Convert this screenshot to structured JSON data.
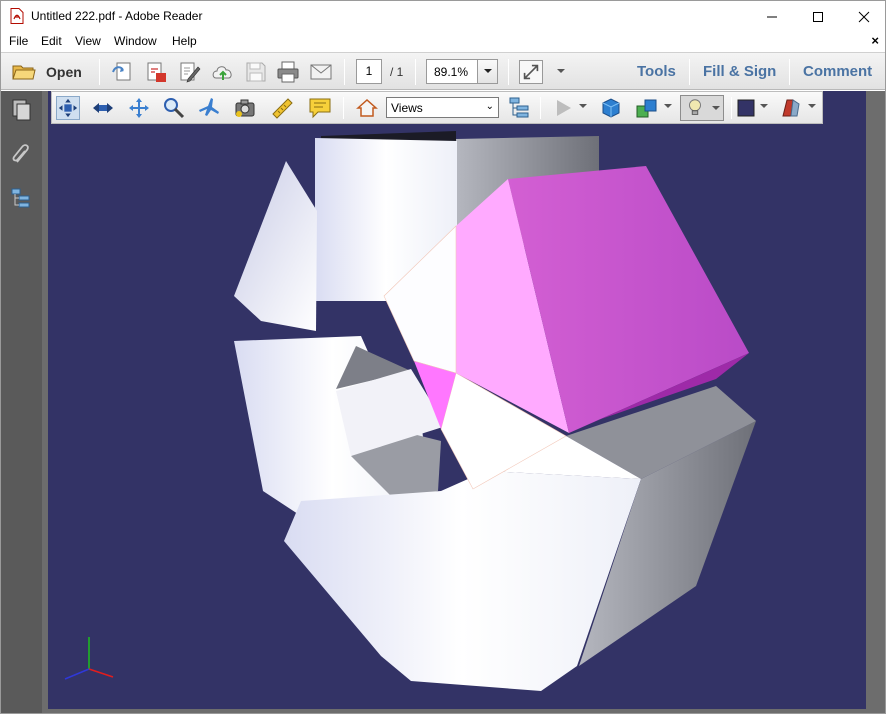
{
  "window": {
    "title": "Untitled 222.pdf - Adobe Reader"
  },
  "menu": {
    "items": [
      "File",
      "Edit",
      "View",
      "Window",
      "Help"
    ],
    "doc_close": "×"
  },
  "toolbar": {
    "open_label": "Open",
    "page_current": "1",
    "page_total": "/ 1",
    "zoom": "89.1%",
    "tools_label": "Tools",
    "fill_sign_label": "Fill & Sign",
    "comment_label": "Comment"
  },
  "toolbar3d": {
    "views_label": "Views",
    "views_dropdown": "⌄"
  },
  "colors": {
    "canvas_bg": "#333366",
    "accent_link": "#4a73a3",
    "highlight_face": "#ff66ff",
    "nav_bg": "#5a5a5a"
  },
  "icons": [
    "pdf-file-icon",
    "minimize-icon",
    "maximize-icon",
    "close-icon",
    "open-folder-icon",
    "create-pdf-icon",
    "export-pdf-icon",
    "edit-pdf-icon",
    "upload-cloud-icon",
    "save-icon",
    "print-icon",
    "email-icon",
    "fit-page-icon",
    "more-icon",
    "pages-panel-icon",
    "attachment-icon",
    "model-tree-icon",
    "rotate-icon",
    "spin-icon",
    "pan-icon",
    "zoom-icon",
    "fly-icon",
    "camera-icon",
    "measure-icon",
    "comment3d-icon",
    "home-view-icon",
    "model-tree-toggle-icon",
    "play-icon",
    "projection-icon",
    "render-mode-icon",
    "lighting-icon",
    "background-color-icon",
    "cross-section-icon"
  ]
}
